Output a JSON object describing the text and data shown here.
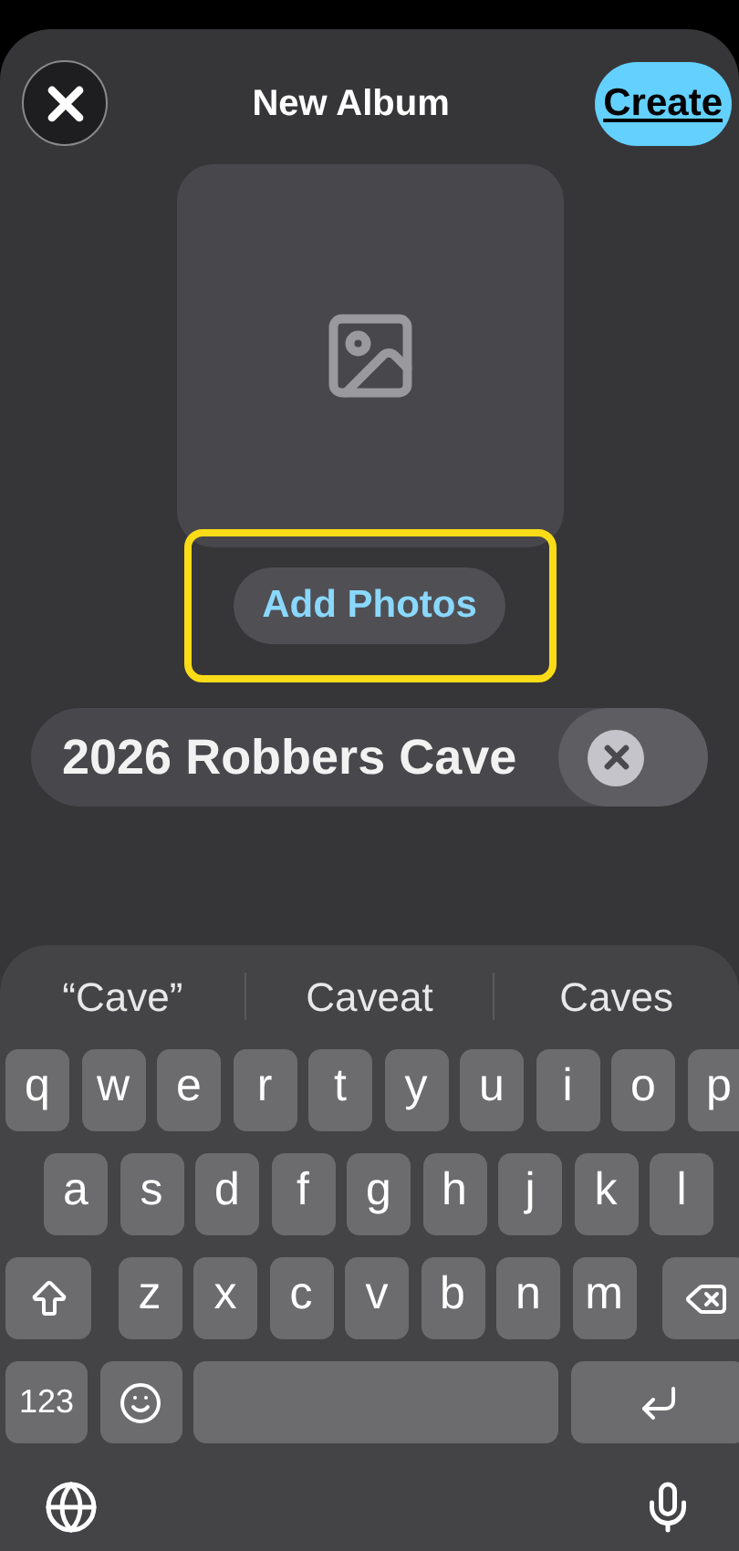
{
  "header": {
    "title": "New Album",
    "create_label": "Create"
  },
  "album": {
    "add_photos_label": "Add Photos",
    "highlighted": true
  },
  "name_field": {
    "value": "2026 Robbers Cave"
  },
  "keyboard": {
    "suggestions": [
      "“Cave”",
      "Caveat",
      "Caves"
    ],
    "rows": [
      [
        {
          "kind": "letter",
          "label": "q"
        },
        {
          "kind": "letter",
          "label": "w"
        },
        {
          "kind": "letter",
          "label": "e"
        },
        {
          "kind": "letter",
          "label": "r"
        },
        {
          "kind": "letter",
          "label": "t"
        },
        {
          "kind": "letter",
          "label": "y"
        },
        {
          "kind": "letter",
          "label": "u"
        },
        {
          "kind": "letter",
          "label": "i"
        },
        {
          "kind": "letter",
          "label": "o"
        },
        {
          "kind": "letter",
          "label": "p"
        }
      ],
      [
        {
          "kind": "letter",
          "label": "a"
        },
        {
          "kind": "letter",
          "label": "s"
        },
        {
          "kind": "letter",
          "label": "d"
        },
        {
          "kind": "letter",
          "label": "f"
        },
        {
          "kind": "letter",
          "label": "g"
        },
        {
          "kind": "letter",
          "label": "h"
        },
        {
          "kind": "letter",
          "label": "j"
        },
        {
          "kind": "letter",
          "label": "k"
        },
        {
          "kind": "letter",
          "label": "l"
        }
      ],
      [
        {
          "kind": "shift"
        },
        {
          "kind": "letter",
          "label": "z"
        },
        {
          "kind": "letter",
          "label": "x"
        },
        {
          "kind": "letter",
          "label": "c"
        },
        {
          "kind": "letter",
          "label": "v"
        },
        {
          "kind": "letter",
          "label": "b"
        },
        {
          "kind": "letter",
          "label": "n"
        },
        {
          "kind": "letter",
          "label": "m"
        },
        {
          "kind": "backspace"
        }
      ],
      [
        {
          "kind": "numbers",
          "label": "123"
        },
        {
          "kind": "emoji"
        },
        {
          "kind": "space"
        },
        {
          "kind": "return"
        }
      ]
    ]
  }
}
